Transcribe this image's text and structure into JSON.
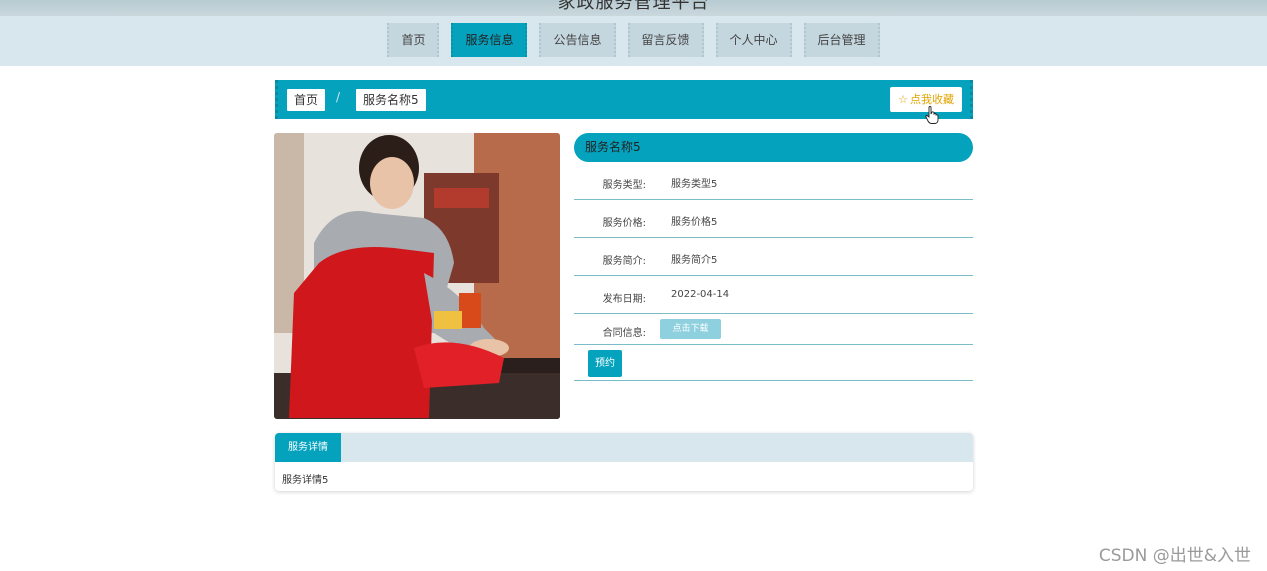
{
  "site": {
    "title": "家政服务管理平台"
  },
  "nav": {
    "items": [
      {
        "label": "首页"
      },
      {
        "label": "服务信息",
        "active": true
      },
      {
        "label": "公告信息"
      },
      {
        "label": "留言反馈"
      },
      {
        "label": "个人中心"
      },
      {
        "label": "后台管理"
      }
    ]
  },
  "breadcrumb": {
    "home": "首页",
    "separator": "/",
    "current": "服务名称5"
  },
  "favorite": {
    "icon": "star-icon",
    "label": "点我收藏"
  },
  "detail": {
    "title": "服务名称5",
    "rows": [
      {
        "label": "服务类型:",
        "value": "服务类型5"
      },
      {
        "label": "服务价格:",
        "value": "服务价格5"
      },
      {
        "label": "服务简介:",
        "value": "服务简介5"
      },
      {
        "label": "发布日期:",
        "value": "2022-04-14"
      }
    ],
    "contract": {
      "label": "合同信息:",
      "button": "点击下载"
    },
    "book_button": "预约"
  },
  "tabs": {
    "active_label": "服务详情",
    "content": "服务详情5"
  },
  "watermark": "CSDN @出世&入世",
  "colors": {
    "accent": "#05a2bd",
    "nav_bg": "#d8e6ee",
    "fav_text": "#e0a400"
  }
}
